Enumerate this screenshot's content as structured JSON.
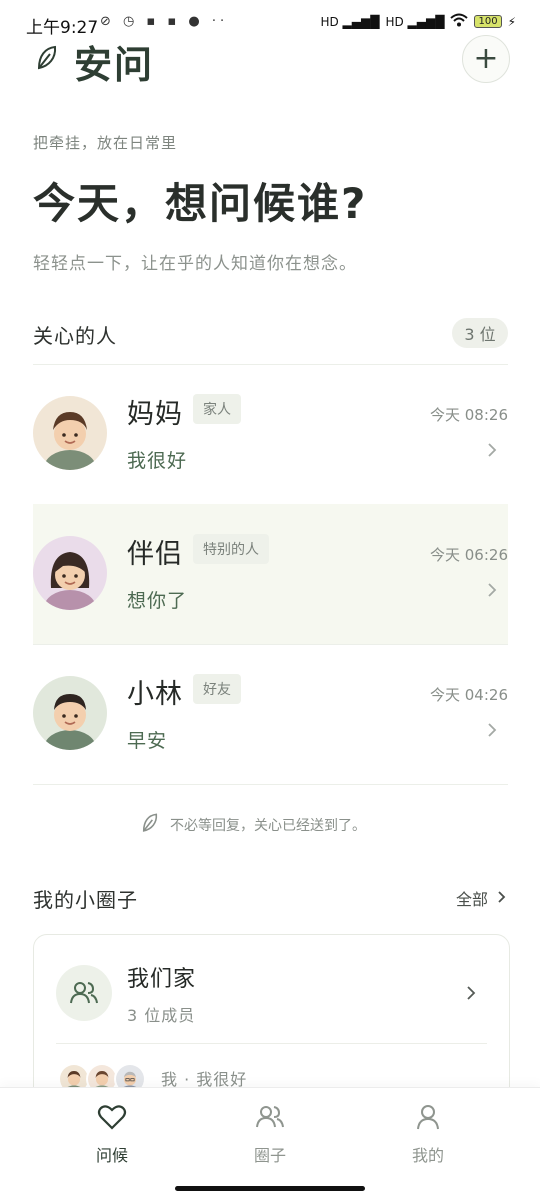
{
  "status_bar": {
    "time": "上午9:27",
    "left_icons": "⊘ ◷ ▪ ▪ ● ··",
    "signal_1": "HD ▂▄▆█",
    "signal_2": "HD ▂▄▆█",
    "wifi": "WiFi",
    "battery": "100"
  },
  "header": {
    "app_title": "安问",
    "add_button": "+"
  },
  "intro": {
    "tagline": "把牵挂，放在日常里",
    "headline": "今天，想问候谁?",
    "subline": "轻轻点一下，让在乎的人知道你在想念。"
  },
  "contacts": {
    "title": "关心的人",
    "count": "3 位",
    "items": [
      {
        "name": "妈妈",
        "tag": "家人",
        "message": "我很好",
        "time": "今天 08:26"
      },
      {
        "name": "伴侣",
        "tag": "特别的人",
        "message": "想你了",
        "time": "今天 06:26"
      },
      {
        "name": "小林",
        "tag": "好友",
        "message": "早安",
        "time": "今天 04:26"
      }
    ],
    "note": "不必等回复，关心已经送到了。"
  },
  "circles": {
    "title": "我的小圈子",
    "all_link": "全部",
    "card": {
      "name": "我们家",
      "members": "3 位成员",
      "status": "我 · 我很好"
    }
  },
  "bottom_nav": {
    "items": [
      {
        "label": "问候",
        "active": true
      },
      {
        "label": "圈子",
        "active": false
      },
      {
        "label": "我的",
        "active": false
      }
    ]
  },
  "colors": {
    "accent": "#2e3e33",
    "message_green": "#4d6a52",
    "selected_row": "#f6f8f0"
  }
}
